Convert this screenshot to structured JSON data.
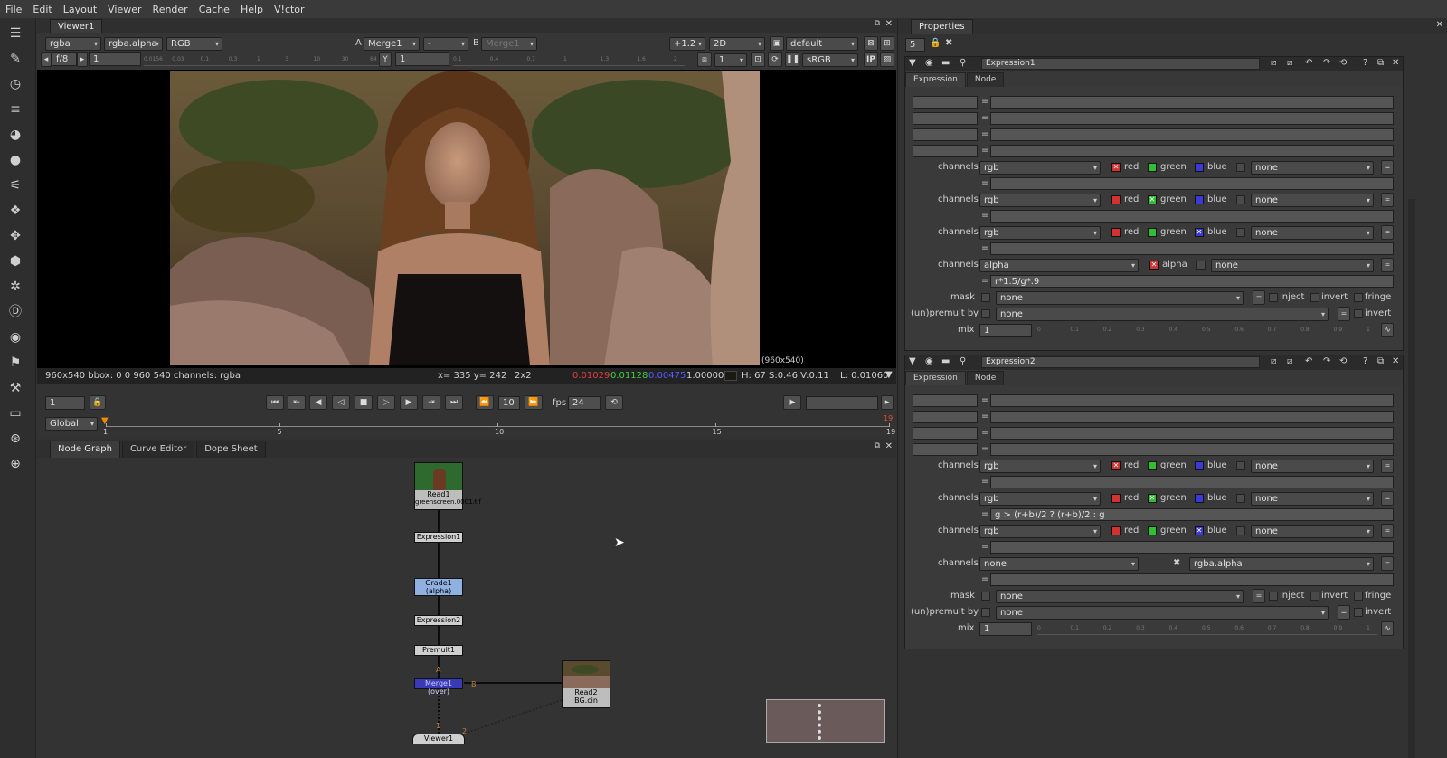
{
  "menu": [
    "File",
    "Edit",
    "Layout",
    "Viewer",
    "Render",
    "Cache",
    "Help",
    "V!ctor"
  ],
  "viewer": {
    "tab": "Viewer1",
    "channels": "rgba",
    "alpha_channel": "rgba.alpha",
    "display_channel": "RGB",
    "input_a_label": "A",
    "input_a": "Merge1",
    "input_a_op": "-",
    "input_b_label": "B",
    "input_b": "Merge1",
    "gain": "+1.2",
    "mode": "2D",
    "lut_default": "default",
    "proxy": "f/8",
    "frame_field": "1",
    "y_label": "Y",
    "y_field": "1",
    "downrez": "1",
    "colorspace": "sRGB",
    "ip_label": "IP",
    "format": "(960x540)",
    "status_left": "960x540 bbox: 0 0 960 540 channels: rgba",
    "status_xy": "x= 335 y= 242",
    "status_zoom": "2x2",
    "status_r": "0.01029",
    "status_g": "0.01128",
    "status_b": "0.00475",
    "status_a": "1.00000",
    "status_hsv": "H: 67 S:0.46 V:0.11",
    "status_l": "L: 0.01060",
    "exposure_ticks": [
      "0.0156",
      "0.03",
      "0.1",
      "0.3",
      "1",
      "3",
      "10",
      "30",
      "64"
    ],
    "gamma_ticks": [
      "0.1",
      "0.4",
      "0.7",
      "1",
      "1.3",
      "1.6",
      "2"
    ]
  },
  "playback": {
    "frame": "1",
    "step": "10",
    "fps_label": "fps",
    "fps": "24",
    "range": "Global",
    "ticks": [
      "1",
      "5",
      "10",
      "15",
      "19"
    ],
    "end_marker": "19"
  },
  "graph_tabs": [
    "Node Graph",
    "Curve Editor",
    "Dope Sheet"
  ],
  "nodes": {
    "read1_name": "Read1",
    "read1_file": "greenscreen.0001.tif",
    "expression1": "Expression1",
    "grade1_name": "Grade1",
    "grade1_sub": "(alpha)",
    "expression2": "Expression2",
    "premult1": "Premult1",
    "merge1": "Merge1 (over)",
    "merge_a": "A",
    "merge_b": "B",
    "read2_name": "Read2",
    "read2_file": "BG.cin",
    "viewer1": "Viewer1",
    "viewer_in1": "1",
    "viewer_in2": "2"
  },
  "properties": {
    "tab": "Properties",
    "max_panels": "5",
    "panels": [
      {
        "title": "Expression1",
        "tabs": [
          "Expression",
          "Node"
        ],
        "rows": [
          {
            "label": "channels",
            "chan": "rgb",
            "checks": [
              "red",
              "green",
              "blue"
            ],
            "checked": "red",
            "extra": "none",
            "expr": ""
          },
          {
            "label": "channels",
            "chan": "rgb",
            "checks": [
              "red",
              "green",
              "blue"
            ],
            "checked": "green",
            "extra": "none",
            "expr": ""
          },
          {
            "label": "channels",
            "chan": "rgb",
            "checks": [
              "red",
              "green",
              "blue"
            ],
            "checked": "blue",
            "extra": "none",
            "expr": ""
          },
          {
            "label": "channels",
            "chan": "alpha",
            "checks": [
              "alpha"
            ],
            "checked": "alpha",
            "extra": "none",
            "expr": "r*1.5/g*.9"
          }
        ],
        "mask_label": "mask",
        "mask": "none",
        "inject": "inject",
        "invert": "invert",
        "fringe": "fringe",
        "unpremult_label": "(un)premult by",
        "unpremult": "none",
        "mix_label": "mix",
        "mix": "1"
      },
      {
        "title": "Expression2",
        "tabs": [
          "Expression",
          "Node"
        ],
        "rows": [
          {
            "label": "channels",
            "chan": "rgb",
            "checks": [
              "red",
              "green",
              "blue"
            ],
            "checked": "red",
            "extra": "none",
            "expr": ""
          },
          {
            "label": "channels",
            "chan": "rgb",
            "checks": [
              "red",
              "green",
              "blue"
            ],
            "checked": "green",
            "extra": "none",
            "expr": "g > (r+b)/2 ? (r+b)/2 : g"
          },
          {
            "label": "channels",
            "chan": "rgb",
            "checks": [
              "red",
              "green",
              "blue"
            ],
            "checked": "blue",
            "extra": "none",
            "expr": ""
          },
          {
            "label": "channels",
            "chan": "none",
            "checks": [],
            "checked": "x",
            "extra": "rgba.alpha",
            "expr": ""
          }
        ],
        "mask_label": "mask",
        "mask": "none",
        "inject": "inject",
        "invert": "invert",
        "fringe": "fringe",
        "unpremult_label": "(un)premult by",
        "unpremult": "none",
        "mix_label": "mix",
        "mix": "1"
      }
    ],
    "mix_ticks": [
      "0",
      "0.1",
      "0.2",
      "0.3",
      "0.4",
      "0.5",
      "0.6",
      "0.7",
      "0.8",
      "0.9",
      "1"
    ]
  },
  "colors": {
    "red": "#d23232",
    "green": "#2fc02f",
    "blue": "#3a3ad8",
    "merge": "#3a3ab8",
    "grade": "#8fb0e0"
  }
}
